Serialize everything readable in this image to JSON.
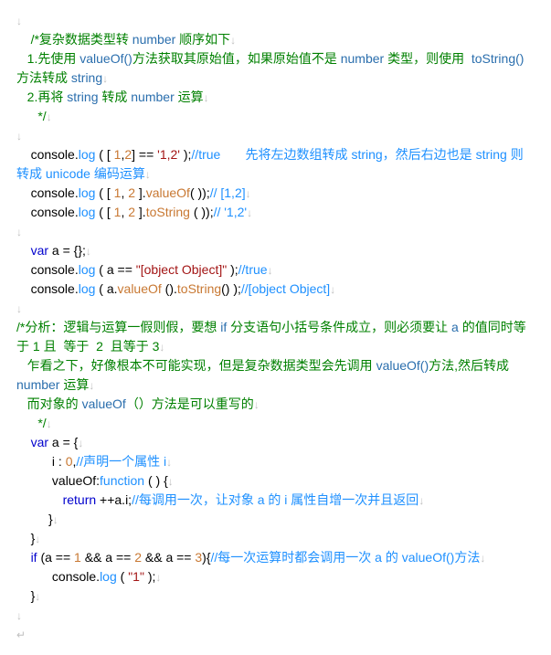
{
  "lines": [
    [
      {
        "t": "↓",
        "c": "arrow"
      }
    ],
    [
      {
        "t": "    ",
        "c": ""
      },
      {
        "t": "/*复杂数据类型转 ",
        "c": "c-cmt"
      },
      {
        "t": "number",
        "c": "c-key"
      },
      {
        "t": " 顺序如下",
        "c": "c-cmt"
      },
      {
        "t": "↓",
        "c": "arrow"
      }
    ],
    [
      {
        "t": "   ",
        "c": ""
      },
      {
        "t": "1.先使用 ",
        "c": "c-cmt"
      },
      {
        "t": "valueOf()",
        "c": "c-key"
      },
      {
        "t": "方法获取其原始值，如果原始值不是 ",
        "c": "c-cmt"
      },
      {
        "t": "number",
        "c": "c-key"
      },
      {
        "t": " 类型，则使用  ",
        "c": "c-cmt"
      },
      {
        "t": "toString()",
        "c": "c-key"
      },
      {
        "t": "方法转成 ",
        "c": "c-cmt"
      },
      {
        "t": "string",
        "c": "c-key"
      },
      {
        "t": "↓",
        "c": "arrow"
      }
    ],
    [
      {
        "t": "   ",
        "c": ""
      },
      {
        "t": "2.再将 ",
        "c": "c-cmt"
      },
      {
        "t": "string",
        "c": "c-key"
      },
      {
        "t": " 转成 ",
        "c": "c-cmt"
      },
      {
        "t": "number",
        "c": "c-key"
      },
      {
        "t": " 运算",
        "c": "c-cmt"
      },
      {
        "t": "↓",
        "c": "arrow"
      }
    ],
    [
      {
        "t": "      ",
        "c": ""
      },
      {
        "t": "*/",
        "c": "c-cmt"
      },
      {
        "t": "↓",
        "c": "arrow"
      }
    ],
    [
      {
        "t": "↓",
        "c": "arrow"
      }
    ],
    [
      {
        "t": "    console.",
        "c": "c-black"
      },
      {
        "t": "log",
        "c": "c-blue"
      },
      {
        "t": " ( [ ",
        "c": "c-black"
      },
      {
        "t": "1",
        "c": "c-num-orange"
      },
      {
        "t": ",",
        "c": "c-black"
      },
      {
        "t": "2",
        "c": "c-num-orange"
      },
      {
        "t": "] == ",
        "c": "c-black"
      },
      {
        "t": "'1,2'",
        "c": "c-str"
      },
      {
        "t": " );",
        "c": "c-black"
      },
      {
        "t": "//true       先将左边数组转成 string，然后右边也是 string 则转成 unicode 编码运算",
        "c": "c-slash"
      },
      {
        "t": "↓",
        "c": "arrow"
      }
    ],
    [
      {
        "t": "    console.",
        "c": "c-black"
      },
      {
        "t": "log",
        "c": "c-blue"
      },
      {
        "t": " ( [ ",
        "c": "c-black"
      },
      {
        "t": "1",
        "c": "c-num-orange"
      },
      {
        "t": ", ",
        "c": "c-black"
      },
      {
        "t": "2 ",
        "c": "c-num-orange"
      },
      {
        "t": "].",
        "c": "c-black"
      },
      {
        "t": "valueOf",
        "c": "c-num-orange"
      },
      {
        "t": "( ));",
        "c": "c-black"
      },
      {
        "t": "// [1,2]",
        "c": "c-slash"
      },
      {
        "t": "↓",
        "c": "arrow"
      }
    ],
    [
      {
        "t": "    console.",
        "c": "c-black"
      },
      {
        "t": "log",
        "c": "c-blue"
      },
      {
        "t": " ( [ ",
        "c": "c-black"
      },
      {
        "t": "1",
        "c": "c-num-orange"
      },
      {
        "t": ", ",
        "c": "c-black"
      },
      {
        "t": "2 ",
        "c": "c-num-orange"
      },
      {
        "t": "].",
        "c": "c-black"
      },
      {
        "t": "toString",
        "c": "c-num-orange"
      },
      {
        "t": " ( ));",
        "c": "c-black"
      },
      {
        "t": "// '1,2'",
        "c": "c-slash"
      },
      {
        "t": "↓",
        "c": "arrow"
      }
    ],
    [
      {
        "t": "↓",
        "c": "arrow"
      }
    ],
    [
      {
        "t": "    ",
        "c": ""
      },
      {
        "t": "var",
        "c": "c-navy"
      },
      {
        "t": " a = {};",
        "c": "c-black"
      },
      {
        "t": "↓",
        "c": "arrow"
      }
    ],
    [
      {
        "t": "    console.",
        "c": "c-black"
      },
      {
        "t": "log",
        "c": "c-blue"
      },
      {
        "t": " ( a == ",
        "c": "c-black"
      },
      {
        "t": "\"[object Object]\"",
        "c": "c-str"
      },
      {
        "t": " );",
        "c": "c-black"
      },
      {
        "t": "//true",
        "c": "c-slash"
      },
      {
        "t": "↓",
        "c": "arrow"
      }
    ],
    [
      {
        "t": "    console.",
        "c": "c-black"
      },
      {
        "t": "log",
        "c": "c-blue"
      },
      {
        "t": " ( a.",
        "c": "c-black"
      },
      {
        "t": "valueOf",
        "c": "c-num-orange"
      },
      {
        "t": " ().",
        "c": "c-black"
      },
      {
        "t": "toString",
        "c": "c-num-orange"
      },
      {
        "t": "() );",
        "c": "c-black"
      },
      {
        "t": "//[object Object]",
        "c": "c-slash"
      },
      {
        "t": "↓",
        "c": "arrow"
      }
    ],
    [
      {
        "t": "↓",
        "c": "arrow"
      }
    ],
    [
      {
        "t": "/*分析：逻辑与运算一假则假，要想 ",
        "c": "c-cmt"
      },
      {
        "t": "if",
        "c": "c-key"
      },
      {
        "t": " 分支语句小括号条件成立，则必须要让 ",
        "c": "c-cmt"
      },
      {
        "t": "a",
        "c": "c-key"
      },
      {
        "t": " 的值同时等于 1 且  等于  2  且等于 3",
        "c": "c-cmt"
      },
      {
        "t": "↓",
        "c": "arrow"
      }
    ],
    [
      {
        "t": "   乍看之下，好像根本不可能实现，但是复杂数据类型会先调用 ",
        "c": "c-cmt"
      },
      {
        "t": "valueOf()",
        "c": "c-key"
      },
      {
        "t": "方法,然后转成",
        "c": "c-cmt"
      },
      {
        "t": "number",
        "c": "c-key"
      },
      {
        "t": " 运算",
        "c": "c-cmt"
      },
      {
        "t": "↓",
        "c": "arrow"
      }
    ],
    [
      {
        "t": "   而对象的 ",
        "c": "c-cmt"
      },
      {
        "t": "valueOf",
        "c": "c-key"
      },
      {
        "t": "（）方法是可以重写的",
        "c": "c-cmt"
      },
      {
        "t": "↓",
        "c": "arrow"
      }
    ],
    [
      {
        "t": "      ",
        "c": ""
      },
      {
        "t": "*/",
        "c": "c-cmt"
      },
      {
        "t": "↓",
        "c": "arrow"
      }
    ],
    [
      {
        "t": "    ",
        "c": ""
      },
      {
        "t": "var",
        "c": "c-navy"
      },
      {
        "t": " a = {",
        "c": "c-black"
      },
      {
        "t": "↓",
        "c": "arrow"
      }
    ],
    [
      {
        "t": "          i : ",
        "c": "c-black"
      },
      {
        "t": "0",
        "c": "c-num-orange"
      },
      {
        "t": ",",
        "c": "c-black"
      },
      {
        "t": "//声明一个属性 i",
        "c": "c-slash"
      },
      {
        "t": "↓",
        "c": "arrow"
      }
    ],
    [
      {
        "t": "          valueOf:",
        "c": "c-black"
      },
      {
        "t": "function",
        "c": "c-blue"
      },
      {
        "t": " ( ) {",
        "c": "c-black"
      },
      {
        "t": "↓",
        "c": "arrow"
      }
    ],
    [
      {
        "t": "             ",
        "c": ""
      },
      {
        "t": "return",
        "c": "c-navy"
      },
      {
        "t": " ++a.i;",
        "c": "c-black"
      },
      {
        "t": "//每调用一次，让对象 a 的 i 属性自增一次并且返回",
        "c": "c-slash"
      },
      {
        "t": "↓",
        "c": "arrow"
      }
    ],
    [
      {
        "t": "         }",
        "c": "c-black"
      },
      {
        "t": "↓",
        "c": "arrow"
      }
    ],
    [
      {
        "t": "    }",
        "c": "c-black"
      },
      {
        "t": "↓",
        "c": "arrow"
      }
    ],
    [
      {
        "t": "    ",
        "c": ""
      },
      {
        "t": "if",
        "c": "c-navy"
      },
      {
        "t": " (a == ",
        "c": "c-black"
      },
      {
        "t": "1",
        "c": "c-num-orange"
      },
      {
        "t": " && a == ",
        "c": "c-black"
      },
      {
        "t": "2",
        "c": "c-num-orange"
      },
      {
        "t": " && a == ",
        "c": "c-black"
      },
      {
        "t": "3",
        "c": "c-num-orange"
      },
      {
        "t": "){",
        "c": "c-black"
      },
      {
        "t": "//每一次运算时都会调用一次 a 的 valueOf()方法",
        "c": "c-slash"
      },
      {
        "t": "↓",
        "c": "arrow"
      }
    ],
    [
      {
        "t": "          console.",
        "c": "c-black"
      },
      {
        "t": "log",
        "c": "c-blue"
      },
      {
        "t": " ( ",
        "c": "c-black"
      },
      {
        "t": "\"1\"",
        "c": "c-str"
      },
      {
        "t": " );",
        "c": "c-black"
      },
      {
        "t": "↓",
        "c": "arrow"
      }
    ],
    [
      {
        "t": "    }",
        "c": "c-black"
      },
      {
        "t": "↓",
        "c": "arrow"
      }
    ],
    [
      {
        "t": "↓",
        "c": "arrow"
      }
    ],
    [
      {
        "t": "↵",
        "c": "arrow"
      }
    ]
  ]
}
